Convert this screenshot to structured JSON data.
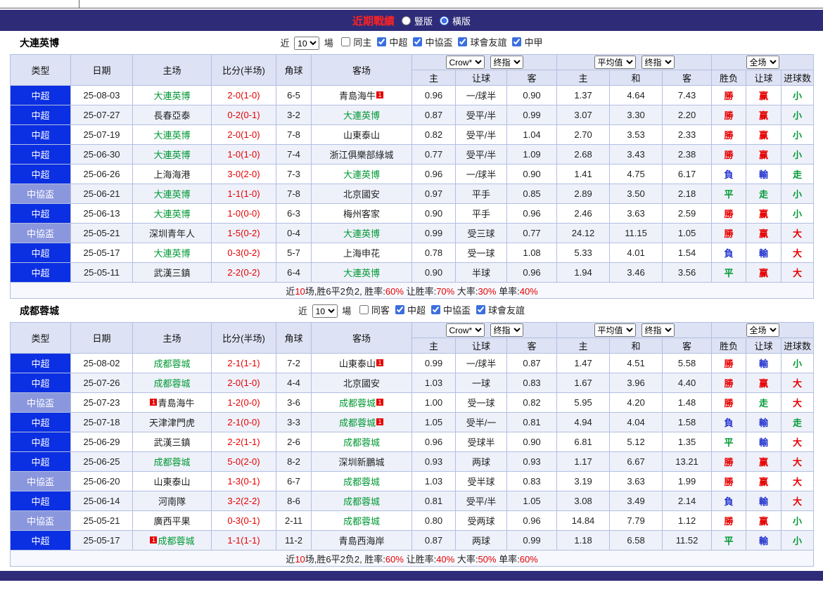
{
  "page": {
    "title": "近期戰績",
    "views": [
      {
        "label": "豎版",
        "checked": false
      },
      {
        "label": "橫版",
        "checked": true
      }
    ]
  },
  "sections": [
    {
      "team": "大連英博",
      "filters": {
        "near": "近",
        "count": "10",
        "games": "場",
        "checks": [
          {
            "label": "同主",
            "checked": false
          },
          {
            "label": "中超",
            "checked": true
          },
          {
            "label": "中協盃",
            "checked": true
          },
          {
            "label": "球會友誼",
            "checked": true
          },
          {
            "label": "中甲",
            "checked": true
          }
        ]
      },
      "header": {
        "type": "类型",
        "date": "日期",
        "home": "主场",
        "score": "比分(半场)",
        "corner": "角球",
        "away": "客场",
        "odds_company": "Crow*",
        "odds_time": "终指",
        "avg_label": "平均值",
        "avg_time": "终指",
        "full": "全场",
        "sub": [
          "主",
          "让球",
          "客",
          "主",
          "和",
          "客",
          "胜负",
          "让球",
          "进球数"
        ]
      },
      "rows": [
        {
          "t": "中超",
          "lg": "csl",
          "d": "25-08-03",
          "h": {
            "n": "大連英博",
            "g": true,
            "b": ""
          },
          "s": "2-0(1-0)",
          "c": "6-5",
          "a": {
            "n": "青島海牛",
            "g": false,
            "b": "after"
          },
          "o": [
            "0.96",
            "一/球半",
            "0.90"
          ],
          "e": [
            "1.37",
            "4.64",
            "7.43"
          ],
          "r": [
            [
              "勝",
              "red"
            ],
            [
              "赢",
              "red"
            ],
            [
              "小",
              "green"
            ]
          ]
        },
        {
          "t": "中超",
          "lg": "csl",
          "d": "25-07-27",
          "h": {
            "n": "長春亞泰",
            "g": false,
            "b": ""
          },
          "s": "0-2(0-1)",
          "c": "3-2",
          "a": {
            "n": "大連英博",
            "g": true,
            "b": ""
          },
          "o": [
            "0.87",
            "受平/半",
            "0.99"
          ],
          "e": [
            "3.07",
            "3.30",
            "2.20"
          ],
          "r": [
            [
              "勝",
              "red"
            ],
            [
              "赢",
              "red"
            ],
            [
              "小",
              "green"
            ]
          ]
        },
        {
          "t": "中超",
          "lg": "csl",
          "d": "25-07-19",
          "h": {
            "n": "大連英博",
            "g": true,
            "b": ""
          },
          "s": "2-0(1-0)",
          "c": "7-8",
          "a": {
            "n": "山東泰山",
            "g": false,
            "b": ""
          },
          "o": [
            "0.82",
            "受平/半",
            "1.04"
          ],
          "e": [
            "2.70",
            "3.53",
            "2.33"
          ],
          "r": [
            [
              "勝",
              "red"
            ],
            [
              "赢",
              "red"
            ],
            [
              "小",
              "green"
            ]
          ]
        },
        {
          "t": "中超",
          "lg": "csl",
          "d": "25-06-30",
          "h": {
            "n": "大連英博",
            "g": true,
            "b": ""
          },
          "s": "1-0(1-0)",
          "c": "7-4",
          "a": {
            "n": "浙江俱樂部綠城",
            "g": false,
            "b": ""
          },
          "o": [
            "0.77",
            "受平/半",
            "1.09"
          ],
          "e": [
            "2.68",
            "3.43",
            "2.38"
          ],
          "r": [
            [
              "勝",
              "red"
            ],
            [
              "赢",
              "red"
            ],
            [
              "小",
              "green"
            ]
          ]
        },
        {
          "t": "中超",
          "lg": "csl",
          "d": "25-06-26",
          "h": {
            "n": "上海海港",
            "g": false,
            "b": ""
          },
          "s": "3-0(2-0)",
          "c": "7-3",
          "a": {
            "n": "大連英博",
            "g": true,
            "b": ""
          },
          "o": [
            "0.96",
            "一/球半",
            "0.90"
          ],
          "e": [
            "1.41",
            "4.75",
            "6.17"
          ],
          "r": [
            [
              "負",
              "blue"
            ],
            [
              "輸",
              "blue"
            ],
            [
              "走",
              "green"
            ]
          ]
        },
        {
          "t": "中協盃",
          "lg": "cup",
          "d": "25-06-21",
          "h": {
            "n": "大連英博",
            "g": true,
            "b": ""
          },
          "s": "1-1(1-0)",
          "c": "7-8",
          "a": {
            "n": "北京國安",
            "g": false,
            "b": ""
          },
          "o": [
            "0.97",
            "平手",
            "0.85"
          ],
          "e": [
            "2.89",
            "3.50",
            "2.18"
          ],
          "r": [
            [
              "平",
              "green"
            ],
            [
              "走",
              "green"
            ],
            [
              "小",
              "green"
            ]
          ]
        },
        {
          "t": "中超",
          "lg": "csl",
          "d": "25-06-13",
          "h": {
            "n": "大連英博",
            "g": true,
            "b": ""
          },
          "s": "1-0(0-0)",
          "c": "6-3",
          "a": {
            "n": "梅州客家",
            "g": false,
            "b": ""
          },
          "o": [
            "0.90",
            "平手",
            "0.96"
          ],
          "e": [
            "2.46",
            "3.63",
            "2.59"
          ],
          "r": [
            [
              "勝",
              "red"
            ],
            [
              "赢",
              "red"
            ],
            [
              "小",
              "green"
            ]
          ]
        },
        {
          "t": "中協盃",
          "lg": "cup",
          "d": "25-05-21",
          "h": {
            "n": "深圳青年人",
            "g": false,
            "b": ""
          },
          "s": "1-5(0-2)",
          "c": "0-4",
          "a": {
            "n": "大連英博",
            "g": true,
            "b": ""
          },
          "o": [
            "0.99",
            "受三球",
            "0.77"
          ],
          "e": [
            "24.12",
            "11.15",
            "1.05"
          ],
          "r": [
            [
              "勝",
              "red"
            ],
            [
              "赢",
              "red"
            ],
            [
              "大",
              "red"
            ]
          ]
        },
        {
          "t": "中超",
          "lg": "csl",
          "d": "25-05-17",
          "h": {
            "n": "大連英博",
            "g": true,
            "b": ""
          },
          "s": "0-3(0-2)",
          "c": "5-7",
          "a": {
            "n": "上海申花",
            "g": false,
            "b": ""
          },
          "o": [
            "0.78",
            "受一球",
            "1.08"
          ],
          "e": [
            "5.33",
            "4.01",
            "1.54"
          ],
          "r": [
            [
              "負",
              "blue"
            ],
            [
              "輸",
              "blue"
            ],
            [
              "大",
              "red"
            ]
          ]
        },
        {
          "t": "中超",
          "lg": "csl",
          "d": "25-05-11",
          "h": {
            "n": "武漢三鎮",
            "g": false,
            "b": ""
          },
          "s": "2-2(0-2)",
          "c": "6-4",
          "a": {
            "n": "大連英博",
            "g": true,
            "b": ""
          },
          "o": [
            "0.90",
            "半球",
            "0.96"
          ],
          "e": [
            "1.94",
            "3.46",
            "3.56"
          ],
          "r": [
            [
              "平",
              "green"
            ],
            [
              "赢",
              "red"
            ],
            [
              "大",
              "red"
            ]
          ]
        }
      ],
      "summary": [
        [
          "近",
          false
        ],
        [
          "10",
          true
        ],
        [
          "场,胜6平2负2, 胜率:",
          false
        ],
        [
          "60%",
          true
        ],
        [
          " 让胜率:",
          false
        ],
        [
          "70%",
          true
        ],
        [
          " 大率:",
          false
        ],
        [
          "30%",
          true
        ],
        [
          " 单率:",
          false
        ],
        [
          "40%",
          true
        ]
      ]
    },
    {
      "team": "成都蓉城",
      "filters": {
        "near": "近",
        "count": "10",
        "games": "場",
        "checks": [
          {
            "label": "同客",
            "checked": false
          },
          {
            "label": "中超",
            "checked": true
          },
          {
            "label": "中協盃",
            "checked": true
          },
          {
            "label": "球會友誼",
            "checked": true
          }
        ]
      },
      "header": {
        "type": "类型",
        "date": "日期",
        "home": "主场",
        "score": "比分(半场)",
        "corner": "角球",
        "away": "客场",
        "odds_company": "Crow*",
        "odds_time": "终指",
        "avg_label": "平均值",
        "avg_time": "终指",
        "full": "全场",
        "sub": [
          "主",
          "让球",
          "客",
          "主",
          "和",
          "客",
          "胜负",
          "让球",
          "进球数"
        ]
      },
      "rows": [
        {
          "t": "中超",
          "lg": "csl",
          "d": "25-08-02",
          "h": {
            "n": "成都蓉城",
            "g": true,
            "b": ""
          },
          "s": "2-1(1-1)",
          "c": "7-2",
          "a": {
            "n": "山東泰山",
            "g": false,
            "b": "after"
          },
          "o": [
            "0.99",
            "一/球半",
            "0.87"
          ],
          "e": [
            "1.47",
            "4.51",
            "5.58"
          ],
          "r": [
            [
              "勝",
              "red"
            ],
            [
              "輸",
              "blue"
            ],
            [
              "小",
              "green"
            ]
          ]
        },
        {
          "t": "中超",
          "lg": "csl",
          "d": "25-07-26",
          "h": {
            "n": "成都蓉城",
            "g": true,
            "b": ""
          },
          "s": "2-0(1-0)",
          "c": "4-4",
          "a": {
            "n": "北京國安",
            "g": false,
            "b": ""
          },
          "o": [
            "1.03",
            "一球",
            "0.83"
          ],
          "e": [
            "1.67",
            "3.96",
            "4.40"
          ],
          "r": [
            [
              "勝",
              "red"
            ],
            [
              "赢",
              "red"
            ],
            [
              "大",
              "red"
            ]
          ]
        },
        {
          "t": "中協盃",
          "lg": "cup",
          "d": "25-07-23",
          "h": {
            "n": "青島海牛",
            "g": false,
            "b": "before"
          },
          "s": "1-2(0-0)",
          "c": "3-6",
          "a": {
            "n": "成都蓉城",
            "g": true,
            "b": "after"
          },
          "o": [
            "1.00",
            "受一球",
            "0.82"
          ],
          "e": [
            "5.95",
            "4.20",
            "1.48"
          ],
          "r": [
            [
              "勝",
              "red"
            ],
            [
              "走",
              "green"
            ],
            [
              "大",
              "red"
            ]
          ]
        },
        {
          "t": "中超",
          "lg": "csl",
          "d": "25-07-18",
          "h": {
            "n": "天津津門虎",
            "g": false,
            "b": ""
          },
          "s": "2-1(0-0)",
          "c": "3-3",
          "a": {
            "n": "成都蓉城",
            "g": true,
            "b": "after"
          },
          "o": [
            "1.05",
            "受半/一",
            "0.81"
          ],
          "e": [
            "4.94",
            "4.04",
            "1.58"
          ],
          "r": [
            [
              "負",
              "blue"
            ],
            [
              "輸",
              "blue"
            ],
            [
              "走",
              "green"
            ]
          ]
        },
        {
          "t": "中超",
          "lg": "csl",
          "d": "25-06-29",
          "h": {
            "n": "武漢三鎮",
            "g": false,
            "b": ""
          },
          "s": "2-2(1-1)",
          "c": "2-6",
          "a": {
            "n": "成都蓉城",
            "g": true,
            "b": ""
          },
          "o": [
            "0.96",
            "受球半",
            "0.90"
          ],
          "e": [
            "6.81",
            "5.12",
            "1.35"
          ],
          "r": [
            [
              "平",
              "green"
            ],
            [
              "輸",
              "blue"
            ],
            [
              "大",
              "red"
            ]
          ]
        },
        {
          "t": "中超",
          "lg": "csl",
          "d": "25-06-25",
          "h": {
            "n": "成都蓉城",
            "g": true,
            "b": ""
          },
          "s": "5-0(2-0)",
          "c": "8-2",
          "a": {
            "n": "深圳新鵬城",
            "g": false,
            "b": ""
          },
          "o": [
            "0.93",
            "两球",
            "0.93"
          ],
          "e": [
            "1.17",
            "6.67",
            "13.21"
          ],
          "r": [
            [
              "勝",
              "red"
            ],
            [
              "赢",
              "red"
            ],
            [
              "大",
              "red"
            ]
          ]
        },
        {
          "t": "中協盃",
          "lg": "cup",
          "d": "25-06-20",
          "h": {
            "n": "山東泰山",
            "g": false,
            "b": ""
          },
          "s": "1-3(0-1)",
          "c": "6-7",
          "a": {
            "n": "成都蓉城",
            "g": true,
            "b": ""
          },
          "o": [
            "1.03",
            "受半球",
            "0.83"
          ],
          "e": [
            "3.19",
            "3.63",
            "1.99"
          ],
          "r": [
            [
              "勝",
              "red"
            ],
            [
              "赢",
              "red"
            ],
            [
              "大",
              "red"
            ]
          ]
        },
        {
          "t": "中超",
          "lg": "csl",
          "d": "25-06-14",
          "h": {
            "n": "河南隊",
            "g": false,
            "b": ""
          },
          "s": "3-2(2-2)",
          "c": "8-6",
          "a": {
            "n": "成都蓉城",
            "g": true,
            "b": ""
          },
          "o": [
            "0.81",
            "受平/半",
            "1.05"
          ],
          "e": [
            "3.08",
            "3.49",
            "2.14"
          ],
          "r": [
            [
              "負",
              "blue"
            ],
            [
              "輸",
              "blue"
            ],
            [
              "大",
              "red"
            ]
          ]
        },
        {
          "t": "中協盃",
          "lg": "cup",
          "d": "25-05-21",
          "h": {
            "n": "廣西平果",
            "g": false,
            "b": ""
          },
          "s": "0-3(0-1)",
          "c": "2-11",
          "a": {
            "n": "成都蓉城",
            "g": true,
            "b": ""
          },
          "o": [
            "0.80",
            "受两球",
            "0.96"
          ],
          "e": [
            "14.84",
            "7.79",
            "1.12"
          ],
          "r": [
            [
              "勝",
              "red"
            ],
            [
              "赢",
              "red"
            ],
            [
              "小",
              "green"
            ]
          ]
        },
        {
          "t": "中超",
          "lg": "csl",
          "d": "25-05-17",
          "h": {
            "n": "成都蓉城",
            "g": true,
            "b": "before"
          },
          "s": "1-1(1-1)",
          "c": "11-2",
          "a": {
            "n": "青島西海岸",
            "g": false,
            "b": ""
          },
          "o": [
            "0.87",
            "两球",
            "0.99"
          ],
          "e": [
            "1.18",
            "6.58",
            "11.52"
          ],
          "r": [
            [
              "平",
              "green"
            ],
            [
              "輸",
              "blue"
            ],
            [
              "小",
              "green"
            ]
          ]
        }
      ],
      "summary": [
        [
          "近",
          false
        ],
        [
          "10",
          true
        ],
        [
          "场,胜6平2负2, 胜率:",
          false
        ],
        [
          "60%",
          true
        ],
        [
          " 让胜率:",
          false
        ],
        [
          "40%",
          true
        ],
        [
          " 大率:",
          false
        ],
        [
          "50%",
          true
        ],
        [
          " 单率:",
          false
        ],
        [
          "60%",
          true
        ]
      ]
    }
  ]
}
